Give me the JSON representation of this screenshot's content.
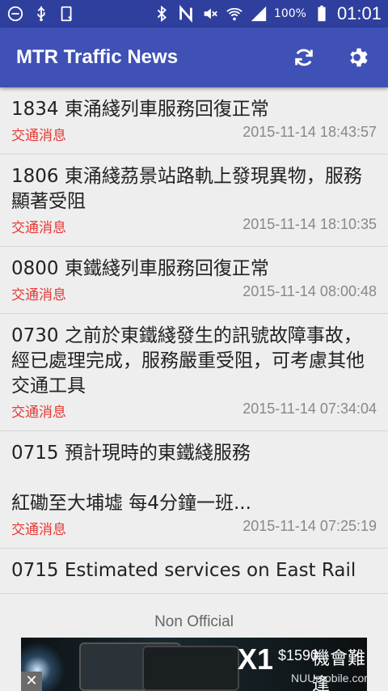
{
  "status_bar": {
    "battery": "100%",
    "time": "01:01"
  },
  "app_bar": {
    "title": "MTR Traffic News",
    "refresh_icon": "refresh-icon",
    "settings_icon": "gear-icon"
  },
  "news": [
    {
      "title": "1834 東涌綫列車服務回復正常",
      "category": "交通消息",
      "time": "2015-11-14 18:43:57"
    },
    {
      "title": "1806 東涌綫茘景站路軌上發現異物，服務顯著受阻",
      "category": "交通消息",
      "time": "2015-11-14 18:10:35"
    },
    {
      "title": "0800 東鐵綫列車服務回復正常",
      "category": "交通消息",
      "time": "2015-11-14 08:00:48"
    },
    {
      "title": "0730 之前於東鐵綫發生的訊號故障事故，經已處理完成，服務嚴重受阻，可考慮其他交通工具",
      "category": "交通消息",
      "time": "2015-11-14 07:34:04"
    },
    {
      "title": "0715 預計現時的東鐵綫服務\n\n紅磡至大埔墟 每4分鐘一班...",
      "category": "交通消息",
      "time": "2015-11-14 07:25:19"
    },
    {
      "title": "0715 Estimated services on East Rail",
      "category": "",
      "time": ""
    }
  ],
  "footer": {
    "label": "Non Official"
  },
  "ad": {
    "brand": "X1",
    "price": "$1590",
    "slogan": "機會難逢",
    "url": "NUUmobile.com",
    "close": "✕"
  },
  "colors": {
    "app_bar": "#3f51b5",
    "status_bar": "#2f3f9e",
    "category": "#e53935"
  }
}
